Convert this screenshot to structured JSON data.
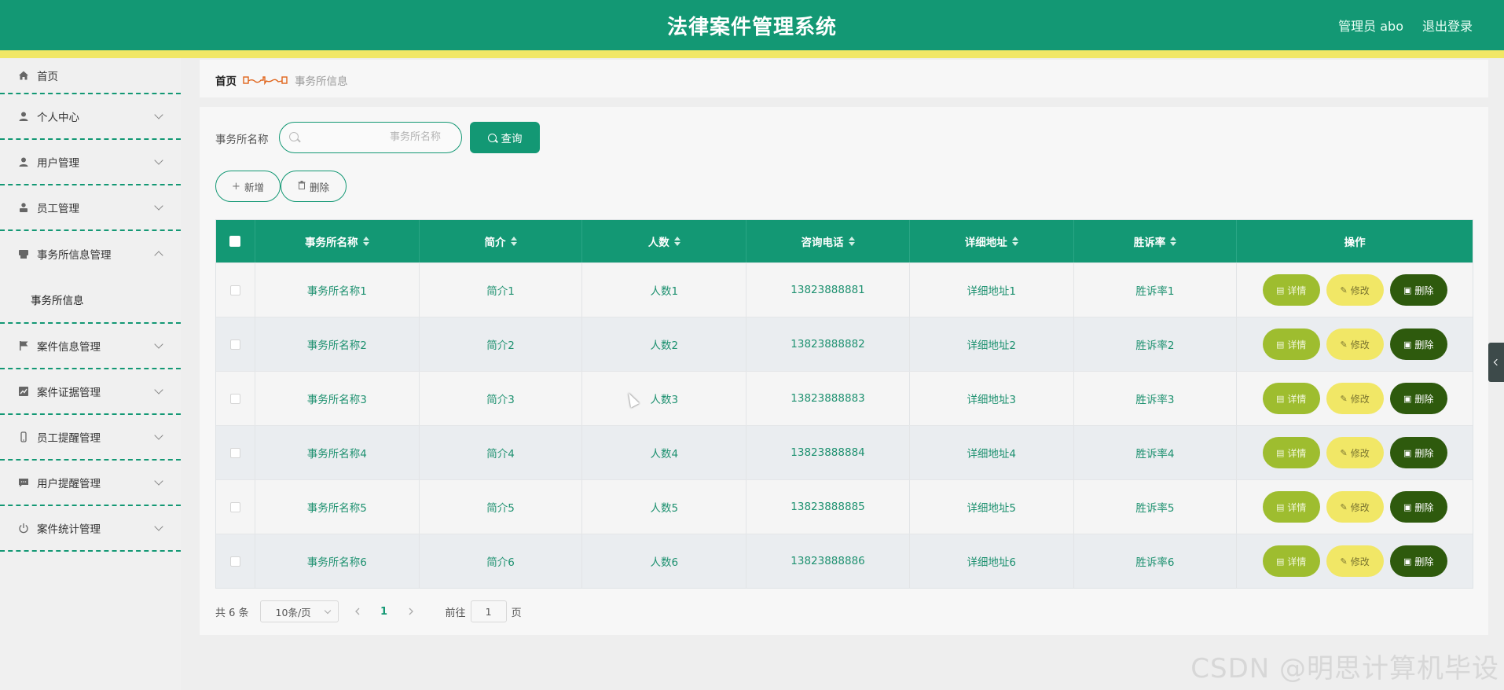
{
  "header": {
    "title": "法律案件管理系统",
    "admin": "管理员 abo",
    "logout": "退出登录"
  },
  "sidebar": {
    "items": [
      {
        "label": "首页",
        "icon": "home-icon"
      },
      {
        "label": "个人中心",
        "icon": "user-icon"
      },
      {
        "label": "用户管理",
        "icon": "user-icon"
      },
      {
        "label": "员工管理",
        "icon": "user-icon"
      },
      {
        "label": "事务所信息管理",
        "icon": "printer-icon",
        "expanded": true,
        "sub": "事务所信息"
      },
      {
        "label": "案件信息管理",
        "icon": "flag-icon"
      },
      {
        "label": "案件证据管理",
        "icon": "chart-icon"
      },
      {
        "label": "员工提醒管理",
        "icon": "phone-icon"
      },
      {
        "label": "用户提醒管理",
        "icon": "chat-icon"
      },
      {
        "label": "案件统计管理",
        "icon": "power-icon"
      }
    ]
  },
  "breadcrumb": {
    "home": "首页",
    "current": "事务所信息"
  },
  "search": {
    "label": "事务所名称",
    "placeholder": "事务所名称",
    "value": "",
    "button": "查询"
  },
  "actions": {
    "add": "新增",
    "delete": "删除"
  },
  "table": {
    "columns": [
      "事务所名称",
      "简介",
      "人数",
      "咨询电话",
      "详细地址",
      "胜诉率",
      "操作"
    ],
    "rows": [
      {
        "name": "事务所名称1",
        "intro": "简介1",
        "count": "人数1",
        "phone": "13823888881",
        "address": "详细地址1",
        "rate": "胜诉率1"
      },
      {
        "name": "事务所名称2",
        "intro": "简介2",
        "count": "人数2",
        "phone": "13823888882",
        "address": "详细地址2",
        "rate": "胜诉率2"
      },
      {
        "name": "事务所名称3",
        "intro": "简介3",
        "count": "人数3",
        "phone": "13823888883",
        "address": "详细地址3",
        "rate": "胜诉率3"
      },
      {
        "name": "事务所名称4",
        "intro": "简介4",
        "count": "人数4",
        "phone": "13823888884",
        "address": "详细地址4",
        "rate": "胜诉率4"
      },
      {
        "name": "事务所名称5",
        "intro": "简介5",
        "count": "人数5",
        "phone": "13823888885",
        "address": "详细地址5",
        "rate": "胜诉率5"
      },
      {
        "name": "事务所名称6",
        "intro": "简介6",
        "count": "人数6",
        "phone": "13823888886",
        "address": "详细地址6",
        "rate": "胜诉率6"
      }
    ],
    "op_labels": {
      "detail": "详情",
      "edit": "修改",
      "delete": "删除"
    }
  },
  "pagination": {
    "total": "共 6 条",
    "page_size": "10条/页",
    "current_page": "1",
    "goto_label": "前往",
    "goto_value": "1",
    "page_suffix": "页"
  },
  "watermark": "CSDN @明思计算机毕设",
  "colors": {
    "primary": "#139874",
    "stripe": "#f1e766",
    "detail": "#9ebd2f",
    "edit": "#f1e766",
    "delete": "#2e5a0d"
  }
}
